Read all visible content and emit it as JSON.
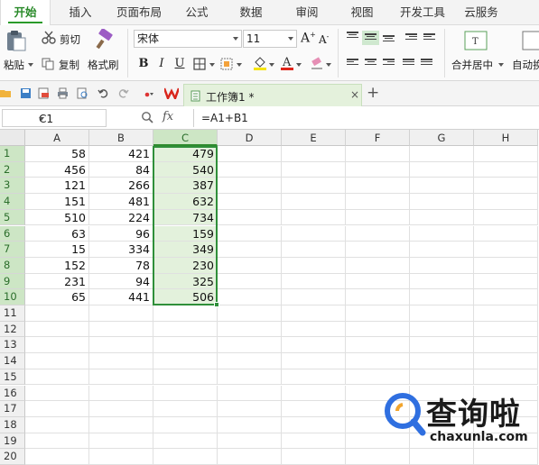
{
  "menu": {
    "tabs": [
      "开始",
      "插入",
      "页面布局",
      "公式",
      "数据",
      "审阅",
      "视图",
      "开发工具",
      "云服务"
    ],
    "active_tab": "开始"
  },
  "ribbon": {
    "paste": "粘贴",
    "cut": "剪切",
    "copy": "复制",
    "format_painter": "格式刷",
    "font_name": "宋体",
    "font_size": "11",
    "bold": "B",
    "italic": "I",
    "underline": "U",
    "merge_center": "合并居中",
    "auto_wrap": "自动换"
  },
  "doc_tab": {
    "title": "工作簿1 *",
    "close": "×",
    "add": "+"
  },
  "formula_bar": {
    "name_box": "C1",
    "fx": "fx",
    "formula": "=A1+B1"
  },
  "sheet": {
    "columns": [
      "A",
      "B",
      "C",
      "D",
      "E",
      "F",
      "G",
      "H"
    ],
    "selected_column": "C",
    "rows": [
      "1",
      "2",
      "3",
      "4",
      "5",
      "6",
      "7",
      "8",
      "9",
      "10",
      "11",
      "12",
      "13",
      "14",
      "15",
      "16",
      "17",
      "18",
      "19",
      "20"
    ],
    "data": [
      [
        "58",
        "421",
        "479"
      ],
      [
        "456",
        "84",
        "540"
      ],
      [
        "121",
        "266",
        "387"
      ],
      [
        "151",
        "481",
        "632"
      ],
      [
        "510",
        "224",
        "734"
      ],
      [
        "63",
        "96",
        "159"
      ],
      [
        "15",
        "334",
        "349"
      ],
      [
        "152",
        "78",
        "230"
      ],
      [
        "231",
        "94",
        "325"
      ],
      [
        "65",
        "441",
        "506"
      ]
    ]
  },
  "watermark": {
    "brand": "查询啦",
    "url": "chaxunla.com"
  },
  "colors": {
    "accent": "#2a9a2a",
    "selection": "#e3f1dc",
    "header_selected": "#cde6c5"
  }
}
